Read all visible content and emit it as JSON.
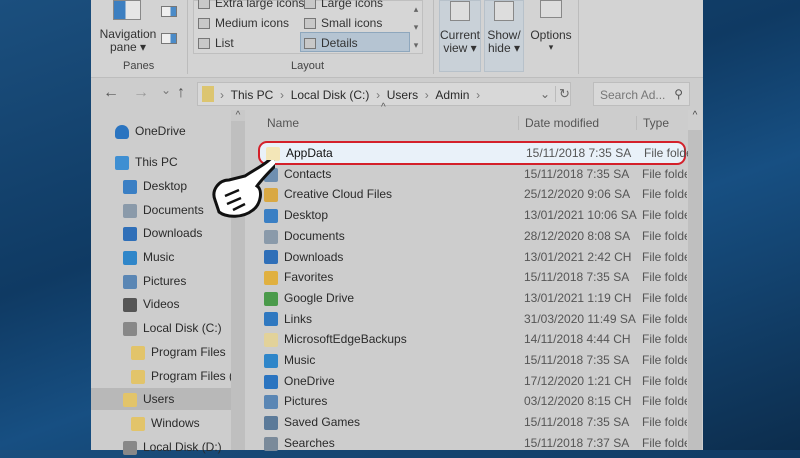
{
  "ribbon": {
    "nav_pane": "Navigation pane ▾",
    "panes": "Panes",
    "layout_items": [
      "Extra large icons",
      "Large icons",
      "Medium icons",
      "Small icons",
      "List",
      "Details"
    ],
    "layout": "Layout",
    "current_view": "Current view ▾",
    "show_hide": "Show/ hide ▾",
    "options": "Options",
    "options_arrow": "▾"
  },
  "address": {
    "back": "←",
    "forward": "→",
    "recent": "⌄",
    "up": "↑",
    "crumbs": [
      "This PC",
      "Local Disk (C:)",
      "Users",
      "Admin"
    ],
    "sep": "›",
    "dropdown": "⌄",
    "refresh": "↻",
    "search_placeholder": "Search Ad...",
    "search_icon": "⚲"
  },
  "nav": [
    {
      "label": "OneDrive",
      "icon": "cloud",
      "color": "#2a74c0"
    },
    {
      "label": "This PC",
      "icon": "monitor",
      "color": "#3f8fd2"
    },
    {
      "label": "Desktop",
      "icon": "desktop",
      "color": "#3a7fc4"
    },
    {
      "label": "Documents",
      "icon": "documents",
      "color": "#8a9aaa"
    },
    {
      "label": "Downloads",
      "icon": "download",
      "color": "#2f6fb8"
    },
    {
      "label": "Music",
      "icon": "music",
      "color": "#2f86c9"
    },
    {
      "label": "Pictures",
      "icon": "pictures",
      "color": "#5a86b4"
    },
    {
      "label": "Videos",
      "icon": "videos",
      "color": "#555"
    },
    {
      "label": "Local Disk (C:)",
      "icon": "drive",
      "color": "#888"
    },
    {
      "label": "Program Files",
      "icon": "folder",
      "color": "#e2c46a"
    },
    {
      "label": "Program Files (",
      "icon": "folder",
      "color": "#e2c46a"
    },
    {
      "label": "Users",
      "icon": "folder",
      "color": "#e2c46a"
    },
    {
      "label": "Windows",
      "icon": "folder",
      "color": "#e2c46a"
    },
    {
      "label": "Local Disk (D:)",
      "icon": "drive",
      "color": "#888"
    }
  ],
  "columns": {
    "name": "Name",
    "date": "Date modified",
    "type": "Type",
    "sort": "^"
  },
  "files": [
    {
      "name": "AppData",
      "date": "15/11/2018 7:35 SA",
      "type": "File folder",
      "color": "#f3e6b8"
    },
    {
      "name": "Contacts",
      "date": "15/11/2018 7:35 SA",
      "type": "File folder",
      "color": "#6f8fb0"
    },
    {
      "name": "Creative Cloud Files",
      "date": "25/12/2020 9:06 SA",
      "type": "File folder",
      "color": "#d9a843"
    },
    {
      "name": "Desktop",
      "date": "13/01/2021 10:06 SA",
      "type": "File folder",
      "color": "#3a7fc4"
    },
    {
      "name": "Documents",
      "date": "28/12/2020 8:08 SA",
      "type": "File folder",
      "color": "#8a9aaa"
    },
    {
      "name": "Downloads",
      "date": "13/01/2021 2:42 CH",
      "type": "File folder",
      "color": "#2f6fb8"
    },
    {
      "name": "Favorites",
      "date": "15/11/2018 7:35 SA",
      "type": "File folder",
      "color": "#e0b040"
    },
    {
      "name": "Google Drive",
      "date": "13/01/2021 1:19 CH",
      "type": "File folder",
      "color": "#4a9a4a"
    },
    {
      "name": "Links",
      "date": "31/03/2020 11:49 SA",
      "type": "File folder",
      "color": "#2f78c0"
    },
    {
      "name": "MicrosoftEdgeBackups",
      "date": "14/11/2018 4:44 CH",
      "type": "File folder",
      "color": "#e2d29a"
    },
    {
      "name": "Music",
      "date": "15/11/2018 7:35 SA",
      "type": "File folder",
      "color": "#2f86c9"
    },
    {
      "name": "OneDrive",
      "date": "17/12/2020 1:21 CH",
      "type": "File folder",
      "color": "#2a74c0"
    },
    {
      "name": "Pictures",
      "date": "03/12/2020 8:15 CH",
      "type": "File folder",
      "color": "#5a86b4"
    },
    {
      "name": "Saved Games",
      "date": "15/11/2018 7:35 SA",
      "type": "File folder",
      "color": "#5b7a99"
    },
    {
      "name": "Searches",
      "date": "15/11/2018 7:37 SA",
      "type": "File folder",
      "color": "#7a8a9a"
    }
  ]
}
